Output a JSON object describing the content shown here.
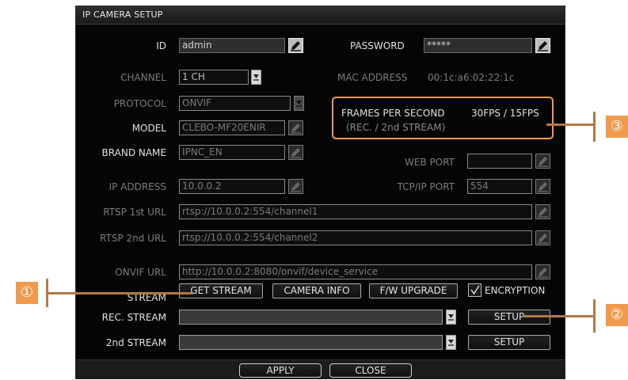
{
  "title": "IP CAMERA SETUP",
  "id": {
    "label": "ID",
    "value": "admin"
  },
  "password": {
    "label": "PASSWORD",
    "value": "*****"
  },
  "channel": {
    "label": "CHANNEL",
    "value": "1 CH"
  },
  "mac": {
    "label": "MAC ADDRESS",
    "value": "00:1c:a6:02:22:1c"
  },
  "protocol": {
    "label": "PROTOCOL",
    "value": "ONVIF"
  },
  "model": {
    "label": "MODEL",
    "value": "CLEBO-MF20ENIR"
  },
  "fps": {
    "label": "FRAMES PER SECOND",
    "value": "30FPS / 15FPS",
    "sub": "(REC. / 2nd STREAM)"
  },
  "brand": {
    "label": "BRAND NAME",
    "value": "IPNC_EN"
  },
  "web_port": {
    "label": "WEB PORT",
    "value": ""
  },
  "ip": {
    "label": "IP ADDRESS",
    "value": "10.0.0.2"
  },
  "tcp_port": {
    "label": "TCP/IP PORT",
    "value": "554"
  },
  "rtsp1": {
    "label": "RTSP 1st URL",
    "value": "rtsp://10.0.0.2:554/channel1"
  },
  "rtsp2": {
    "label": "RTSP 2nd URL",
    "value": "rtsp://10.0.0.2:554/channel2"
  },
  "onvif": {
    "label": "ONVIF URL",
    "value": "http://10.0.0.2:8080/onvif/device_service"
  },
  "stream": {
    "label": "STREAM",
    "get_stream": "GET STREAM",
    "camera_info": "CAMERA INFO",
    "fw_upgrade": "F/W UPGRADE",
    "encryption": "ENCRYPTION",
    "encryption_checked": true
  },
  "rec_stream": {
    "label": "REC. STREAM",
    "value": "",
    "setup": "SETUP"
  },
  "second_stream": {
    "label": "2nd STREAM",
    "value": "",
    "setup": "SETUP"
  },
  "footer": {
    "apply": "APPLY",
    "close": "CLOSE"
  },
  "callouts": {
    "c1": "①",
    "c2": "②",
    "c3": "③"
  },
  "colors": {
    "highlight": "#ec9b52",
    "callout_bg": "#ef9a4c",
    "dialog_bg": "#050505"
  },
  "icons": [
    "edit-icon",
    "dropdown-arrow-icon",
    "checkmark-icon"
  ]
}
